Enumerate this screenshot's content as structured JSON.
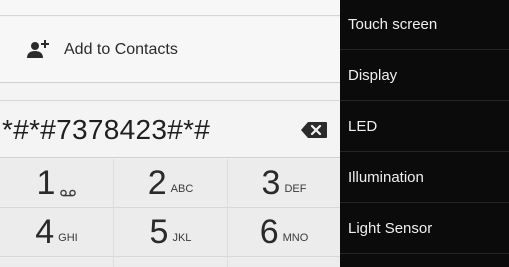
{
  "dialer": {
    "add_contacts": {
      "label": "Add to Contacts",
      "icon": "add-contact-icon"
    },
    "dialed_number": "*#*#7378423#*#",
    "backspace_icon": "backspace-icon",
    "keys": [
      {
        "digit": "1",
        "letters": "",
        "icon": "voicemail-icon"
      },
      {
        "digit": "2",
        "letters": "ABC"
      },
      {
        "digit": "3",
        "letters": "DEF"
      },
      {
        "digit": "4",
        "letters": "GHI"
      },
      {
        "digit": "5",
        "letters": "JKL"
      },
      {
        "digit": "6",
        "letters": "MNO"
      }
    ]
  },
  "menu": {
    "items": [
      {
        "label": "Touch screen"
      },
      {
        "label": "Display"
      },
      {
        "label": "LED"
      },
      {
        "label": "Illumination"
      },
      {
        "label": "Light Sensor"
      }
    ]
  },
  "colors": {
    "menu_background": "#0b0b0b",
    "menu_text": "#f0f0f0",
    "dialer_background": "#f2f2f2"
  }
}
